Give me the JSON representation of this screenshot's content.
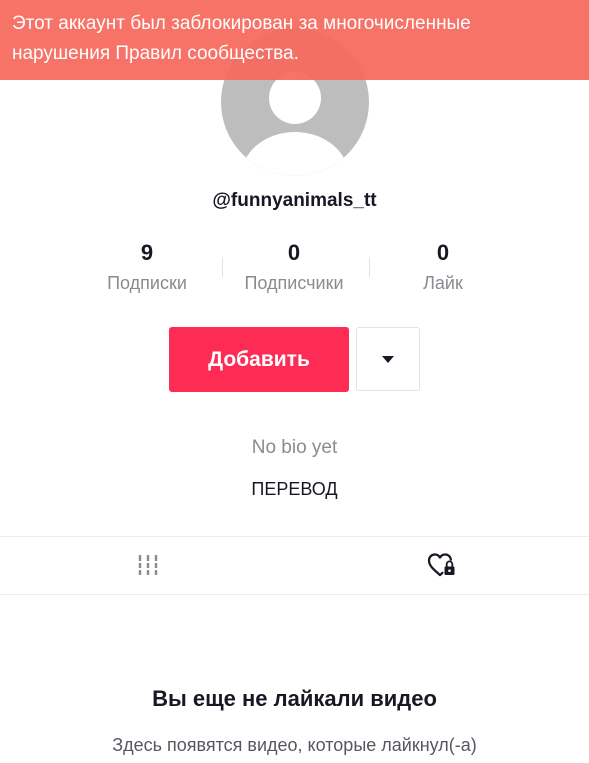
{
  "banner": {
    "line1": "Этот аккаунт был заблокирован за многочисленные",
    "line2": "нарушения Правил сообщества."
  },
  "profile": {
    "avatar_icon": "default-avatar-icon",
    "username": "@funnyanimals_tt",
    "bio": "No bio yet",
    "translate_label": "ПЕРЕВОД"
  },
  "stats": {
    "following": {
      "value": "9",
      "label": "Подписки"
    },
    "followers": {
      "value": "0",
      "label": "Подписчики"
    },
    "likes": {
      "value": "0",
      "label": "Лайк"
    }
  },
  "actions": {
    "follow_label": "Добавить",
    "dropdown_icon": "caret-down-icon"
  },
  "tabs": {
    "videos_icon": "videos-grid-icon",
    "liked_icon": "liked-private-heart-icon"
  },
  "empty_state": {
    "title": "Вы еще не лайкали видео",
    "subtitle": "Здесь появятся видео, которые лайкнул(-а)"
  },
  "colors": {
    "banner": "#f6685c",
    "follow_button": "#fe2c55",
    "text_primary": "#161823",
    "text_secondary": "#8a8b91"
  }
}
